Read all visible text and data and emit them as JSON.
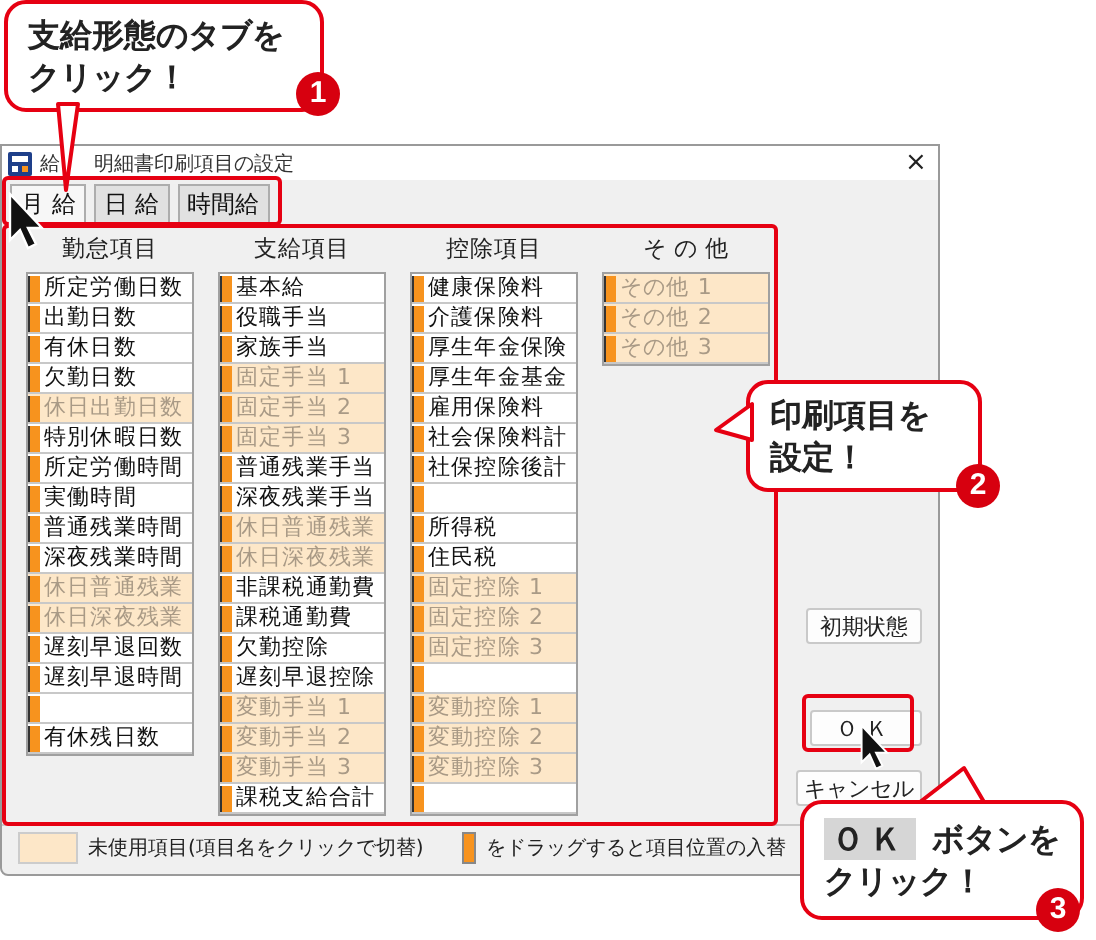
{
  "callouts": [
    {
      "lines": [
        "支給形態のタブを",
        "クリック！"
      ],
      "badge": "1"
    },
    {
      "lines": [
        "印刷項目を",
        "設定！"
      ],
      "badge": "2"
    },
    {
      "key": "ＯＫ",
      "lines": [
        "ボタンを",
        "クリック！"
      ],
      "badge": "3"
    }
  ],
  "window": {
    "title_parts": [
      "給",
      "明細書印刷項目の設定"
    ],
    "close": "×"
  },
  "tabs": [
    {
      "label": "月 給",
      "selected": true
    },
    {
      "label": "日 給",
      "selected": false
    },
    {
      "label": "時間給",
      "selected": false
    }
  ],
  "columns": [
    {
      "header": "勤怠項目",
      "items": [
        {
          "label": "所定労働日数",
          "used": true
        },
        {
          "label": "出勤日数",
          "used": true
        },
        {
          "label": "有休日数",
          "used": true
        },
        {
          "label": "欠勤日数",
          "used": true
        },
        {
          "label": "休日出勤日数",
          "used": false
        },
        {
          "label": "特別休暇日数",
          "used": true
        },
        {
          "label": "所定労働時間",
          "used": true
        },
        {
          "label": "実働時間",
          "used": true
        },
        {
          "label": "普通残業時間",
          "used": true
        },
        {
          "label": "深夜残業時間",
          "used": true
        },
        {
          "label": "休日普通残業",
          "used": false
        },
        {
          "label": "休日深夜残業",
          "used": false
        },
        {
          "label": "遅刻早退回数",
          "used": true
        },
        {
          "label": "遅刻早退時間",
          "used": true
        },
        {
          "used": true
        },
        {
          "label": "有休残日数",
          "used": true
        }
      ]
    },
    {
      "header": "支給項目",
      "items": [
        {
          "label": "基本給",
          "used": true
        },
        {
          "label": "役職手当",
          "used": true
        },
        {
          "label": "家族手当",
          "used": true
        },
        {
          "label": "固定手当 1",
          "used": false
        },
        {
          "label": "固定手当 2",
          "used": false
        },
        {
          "label": "固定手当 3",
          "used": false
        },
        {
          "label": "普通残業手当",
          "used": true
        },
        {
          "label": "深夜残業手当",
          "used": true
        },
        {
          "label": "休日普通残業",
          "used": false
        },
        {
          "label": "休日深夜残業",
          "used": false
        },
        {
          "label": "非課税通勤費",
          "used": true
        },
        {
          "label": "課税通勤費",
          "used": true
        },
        {
          "label": "欠勤控除",
          "used": true
        },
        {
          "label": "遅刻早退控除",
          "used": true
        },
        {
          "label": "変動手当 1",
          "used": false
        },
        {
          "label": "変動手当 2",
          "used": false
        },
        {
          "label": "変動手当 3",
          "used": false
        },
        {
          "label": "課税支給合計",
          "used": true
        }
      ]
    },
    {
      "header": "控除項目",
      "items": [
        {
          "label": "健康保険料",
          "used": true
        },
        {
          "label": "介護保険料",
          "used": true
        },
        {
          "label": "厚生年金保険",
          "used": true
        },
        {
          "label": "厚生年金基金",
          "used": true
        },
        {
          "label": "雇用保険料",
          "used": true
        },
        {
          "label": "社会保険料計",
          "used": true
        },
        {
          "label": "社保控除後計",
          "used": true
        },
        {
          "used": true
        },
        {
          "label": "所得税",
          "used": true
        },
        {
          "label": "住民税",
          "used": true
        },
        {
          "label": "固定控除 1",
          "used": false
        },
        {
          "label": "固定控除 2",
          "used": false
        },
        {
          "label": "固定控除 3",
          "used": false
        },
        {
          "used": true
        },
        {
          "label": "変動控除 1",
          "used": false
        },
        {
          "label": "変動控除 2",
          "used": false
        },
        {
          "label": "変動控除 3",
          "used": false
        },
        {
          "used": true
        }
      ]
    },
    {
      "header": "そ の 他",
      "items": [
        {
          "label": "その他 1",
          "used": false
        },
        {
          "label": "その他 2",
          "used": false
        },
        {
          "label": "その他 3",
          "used": false
        }
      ]
    }
  ],
  "buttons": [
    {
      "label": "初期状態"
    },
    {
      "label": "ＯＫ"
    },
    {
      "label": "キャンセル"
    }
  ],
  "legend": [
    {
      "kind": "unused",
      "text": "未使用項目(項目名をクリックで切替)"
    },
    {
      "kind": "handle",
      "text": "をドラッグすると項目位置の入替"
    }
  ]
}
